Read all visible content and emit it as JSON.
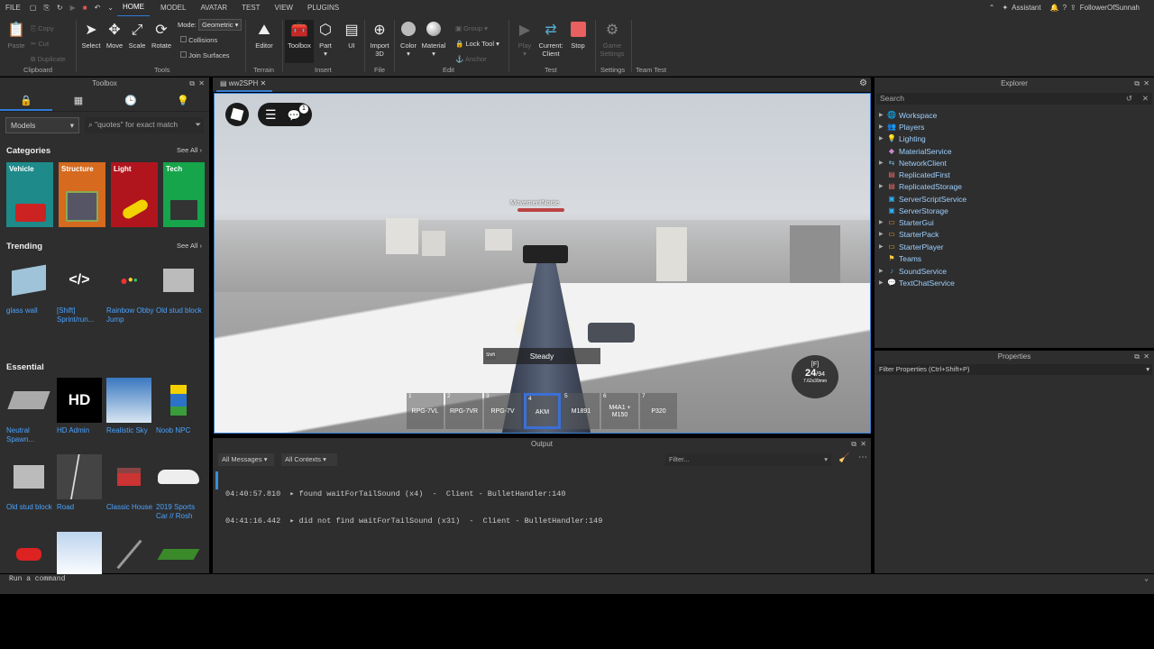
{
  "menu": [
    "FILE",
    "HOME",
    "MODEL",
    "AVATAR",
    "TEST",
    "VIEW",
    "PLUGINS"
  ],
  "user": {
    "assistant": "Assistant",
    "name": "FollowerOfSunnah"
  },
  "ribbon": {
    "clipboard": {
      "paste": "Paste",
      "copy": "Copy",
      "cut": "Cut",
      "duplicate": "Duplicate",
      "group": "Clipboard"
    },
    "tools": {
      "select": "Select",
      "move": "Move",
      "scale": "Scale",
      "rotate": "Rotate",
      "mode_label": "Mode:",
      "mode_value": "Geometric",
      "collisions": "Collisions",
      "join": "Join Surfaces",
      "group": "Tools"
    },
    "terrain": {
      "editor": "Editor",
      "group": "Terrain"
    },
    "insert": {
      "toolbox": "Toolbox",
      "part": "Part",
      "ui": "UI",
      "group": "Insert"
    },
    "file": {
      "import": "Import 3D",
      "group": "File"
    },
    "edit": {
      "color": "Color",
      "material": "Material",
      "group_btn": "Group",
      "lock": "Lock Tool",
      "anchor": "Anchor",
      "group": "Edit"
    },
    "test": {
      "play": "Play",
      "current": "Current: Client",
      "stop": "Stop",
      "group": "Test"
    },
    "settings": {
      "game": "Game Settings",
      "group": "Settings"
    },
    "teamtest": {
      "group": "Team Test"
    }
  },
  "toolbox": {
    "title": "Toolbox",
    "dropdown": "Models",
    "search_placeholder": "\"quotes\" for exact match",
    "categories_label": "Categories",
    "see_all": "See All",
    "categories": [
      "Vehicle",
      "Structure",
      "Light",
      "Tech"
    ],
    "trending_label": "Trending",
    "trending": [
      "glass wall",
      "[Shift] Sprint/run...",
      "Rainbow Obby Jump",
      "Old stud block"
    ],
    "essential_label": "Essential",
    "essential": [
      "Neutral Spawn...",
      "HD Admin",
      "Realistic Sky",
      "Noob NPC",
      "Old stud block",
      "Road",
      "Classic House",
      "2019 Sports Car // Rosh"
    ]
  },
  "viewport": {
    "tab": "ww2SPH",
    "player_name": "MovementNoise",
    "steady": "Steady",
    "shift": "Shift",
    "ammo_key": "[F]",
    "ammo": "24",
    "ammo_total": "/94",
    "caliber": "7.62x39mm",
    "chat_badge": "1",
    "slots": [
      {
        "n": "1",
        "t": "RPG-7VL"
      },
      {
        "n": "2",
        "t": "RPG-7VR"
      },
      {
        "n": "3",
        "t": "RPG-7V"
      },
      {
        "n": "4",
        "t": "AKM"
      },
      {
        "n": "5",
        "t": "M1891"
      },
      {
        "n": "6",
        "t": "M4A1 + M150"
      },
      {
        "n": "7",
        "t": "P320"
      }
    ]
  },
  "explorer": {
    "title": "Explorer",
    "search": "Search",
    "items": [
      "Workspace",
      "Players",
      "Lighting",
      "MaterialService",
      "NetworkClient",
      "ReplicatedFirst",
      "ReplicatedStorage",
      "ServerScriptService",
      "ServerStorage",
      "StarterGui",
      "StarterPack",
      "StarterPlayer",
      "Teams",
      "SoundService",
      "TextChatService"
    ]
  },
  "properties": {
    "title": "Properties",
    "filter": "Filter Properties (Ctrl+Shift+P)"
  },
  "output": {
    "title": "Output",
    "all_messages": "All Messages",
    "all_contexts": "All Contexts",
    "filter": "Filter...",
    "lines": [
      {
        "time": "04:40:57.810",
        "msg": "found waitForTailSound (x4)  -  Client - BulletHandler:140"
      },
      {
        "time": "04:41:16.442",
        "msg": "did not find waitForTailSound (x31)  -  Client - BulletHandler:149"
      }
    ]
  },
  "command": {
    "placeholder": "Run a command"
  }
}
